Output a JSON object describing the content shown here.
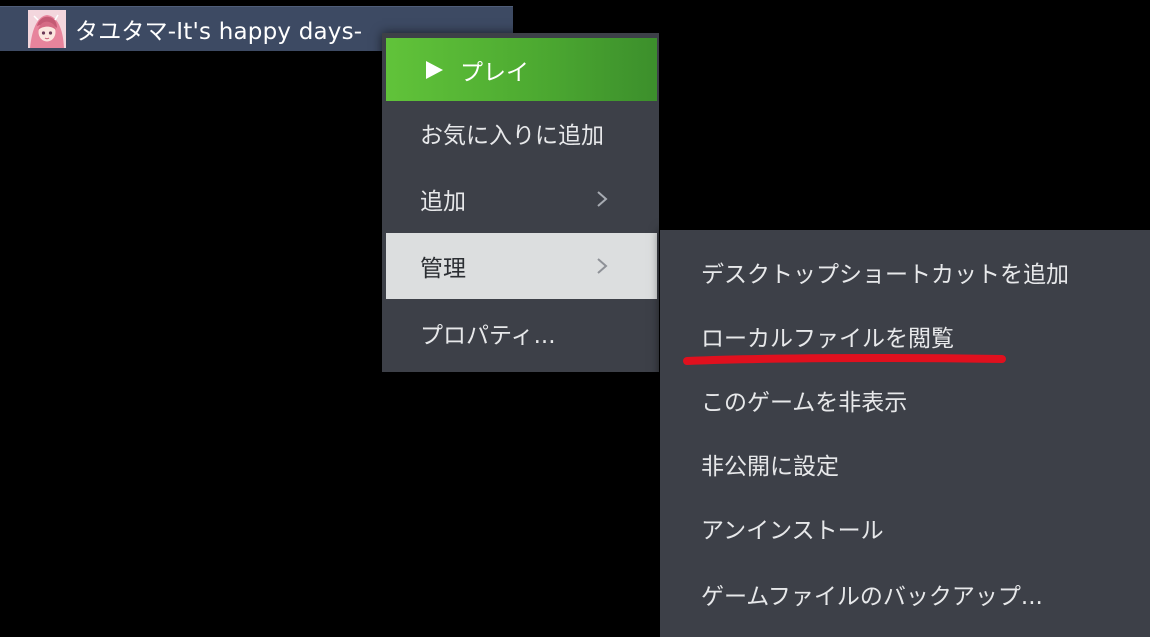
{
  "game": {
    "title": "タユタマ-It's happy days-",
    "thumbnail": "anime-girl-thumbnail"
  },
  "menu": {
    "play_label": "プレイ",
    "play_icon": "play-triangle-icon",
    "favorite_label": "お気に入りに追加",
    "add_label": "追加",
    "manage_label": "管理",
    "properties_label": "プロパティ...",
    "submenu_icon": "chevron-right-icon"
  },
  "submenu": {
    "items": [
      "デスクトップショートカットを追加",
      "ローカルファイルを閲覧",
      "このゲームを非表示",
      "非公開に設定",
      "アンインストール",
      "ゲームファイルのバックアップ..."
    ]
  },
  "annotation": {
    "underline_color": "#e0101e",
    "underlined_item": "ローカルファイルを閲覧"
  },
  "colors": {
    "play_green": "#5bba36",
    "menu_bg": "#3d4048",
    "hover_bg": "#dcdedf",
    "title_bar": "#3d4a63"
  }
}
